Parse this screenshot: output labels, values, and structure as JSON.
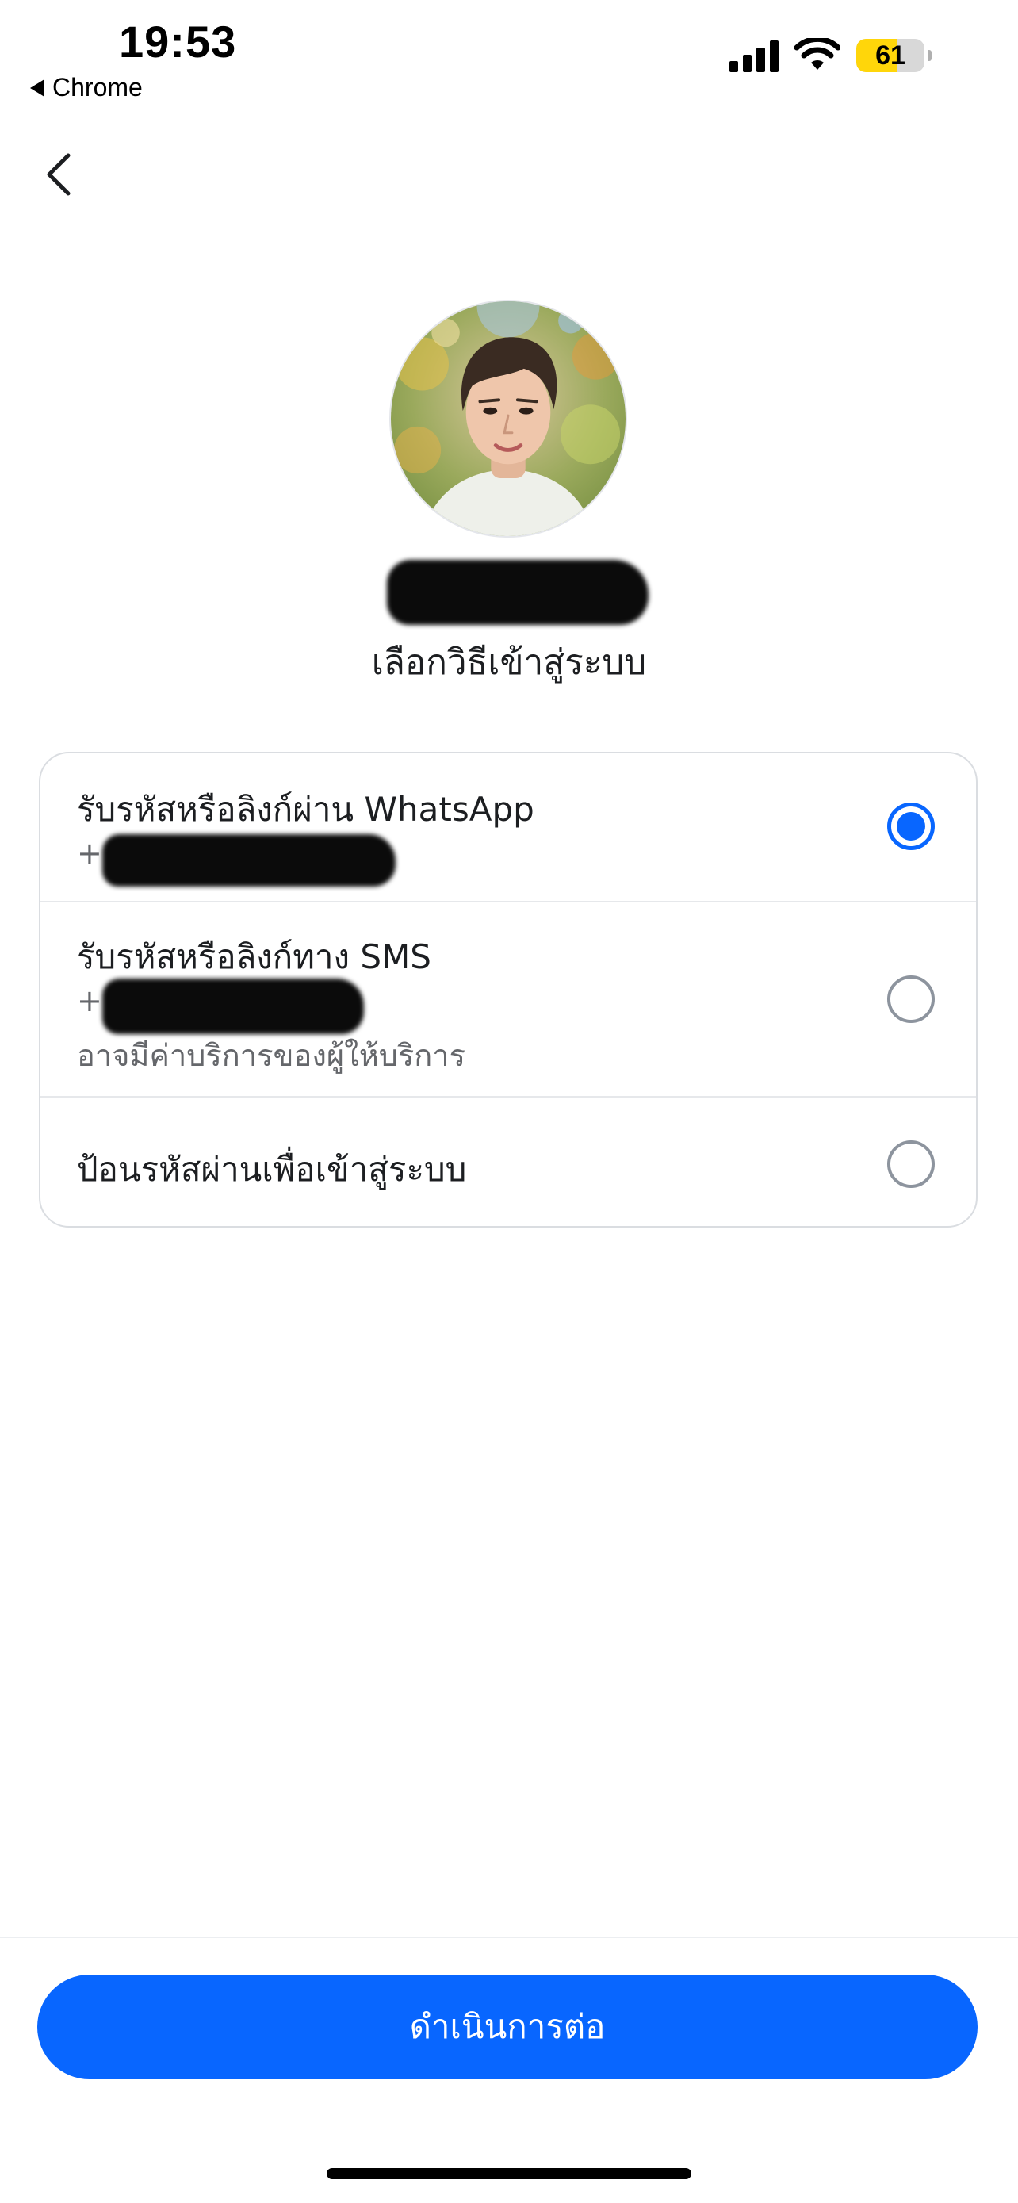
{
  "status_bar": {
    "time": "19:53",
    "back_app_label": "Chrome",
    "battery_percent": 61,
    "battery_label": "61",
    "signal_icon": "cellular-signal-icon",
    "wifi_icon": "wifi-icon"
  },
  "nav": {
    "back_icon": "chevron-left-icon"
  },
  "profile": {
    "subtitle": "เลือกวิธีเข้าสู่ระบบ"
  },
  "options": [
    {
      "title": "รับรหัสหรือลิงก์ผ่าน WhatsApp",
      "phone_prefix": "+",
      "selected": true
    },
    {
      "title": "รับรหัสหรือลิงก์ทาง SMS",
      "phone_prefix": "+",
      "note": "อาจมีค่าบริการของผู้ให้บริการ",
      "selected": false
    },
    {
      "title": "ป้อนรหัสผ่านเพื่อเข้าสู่ระบบ",
      "selected": false
    }
  ],
  "footer": {
    "continue_label": "ดำเนินการต่อ"
  },
  "colors": {
    "accent": "#0866ff",
    "secondary_text": "#65676b",
    "battery_fill": "#ffd60a"
  }
}
